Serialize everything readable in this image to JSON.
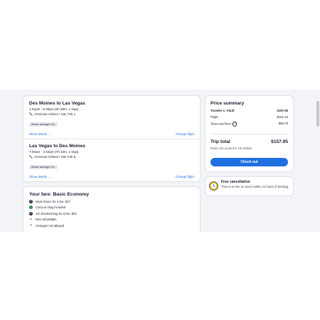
{
  "flights": [
    {
      "title": "Des Moines to Las Vegas",
      "times": "1:01pm - 5:40pm (6h 39m, 1 stop)",
      "airline": "American Airlines • Sat, Feb 1",
      "badge": "Above average CO₂",
      "details_label": "Show details",
      "change_label": "Change flight"
    },
    {
      "title": "Las Vegas to Des Moines",
      "times": "7:00am - 4:34pm (7h 34m, 1 stop)",
      "airline": "American Airlines • Sat, Feb 8",
      "badge": "Above average CO₂",
      "details_label": "Show details",
      "change_label": "Change flight"
    }
  ],
  "fare": {
    "title": "Your fare: Basic Economy",
    "items": [
      {
        "icon": "dollar-icon",
        "text": "Seat choice for a fee: $27"
      },
      {
        "icon": "check-icon",
        "text": "Carry-on bag included"
      },
      {
        "icon": "dollar-icon",
        "text": "1st checked bag for a fee: $40"
      },
      {
        "icon": "x-icon",
        "text": "Non-refundable"
      },
      {
        "icon": "x-icon",
        "text": "Changes not allowed"
      }
    ]
  },
  "price_summary": {
    "title": "Price summary",
    "traveler_label": "Traveler 1: Adult",
    "traveler_value": "$157.95",
    "flight_label": "Flight",
    "flight_value": "$101.16",
    "taxes_label": "Taxes and fees",
    "taxes_value": "$56.79",
    "total_label": "Trip total",
    "total_value": "$157.95",
    "currency_note": "Rates are quoted in US dollars",
    "checkout_label": "Check out"
  },
  "cancellation": {
    "title": "Free cancellation",
    "text": "There's no fee to cancel within 24 hours of booking."
  },
  "colors": {
    "accent": "#1f6fe0",
    "background": "#f3f4f8",
    "badge": "#e6e7ec",
    "clock": "#f5c518"
  }
}
